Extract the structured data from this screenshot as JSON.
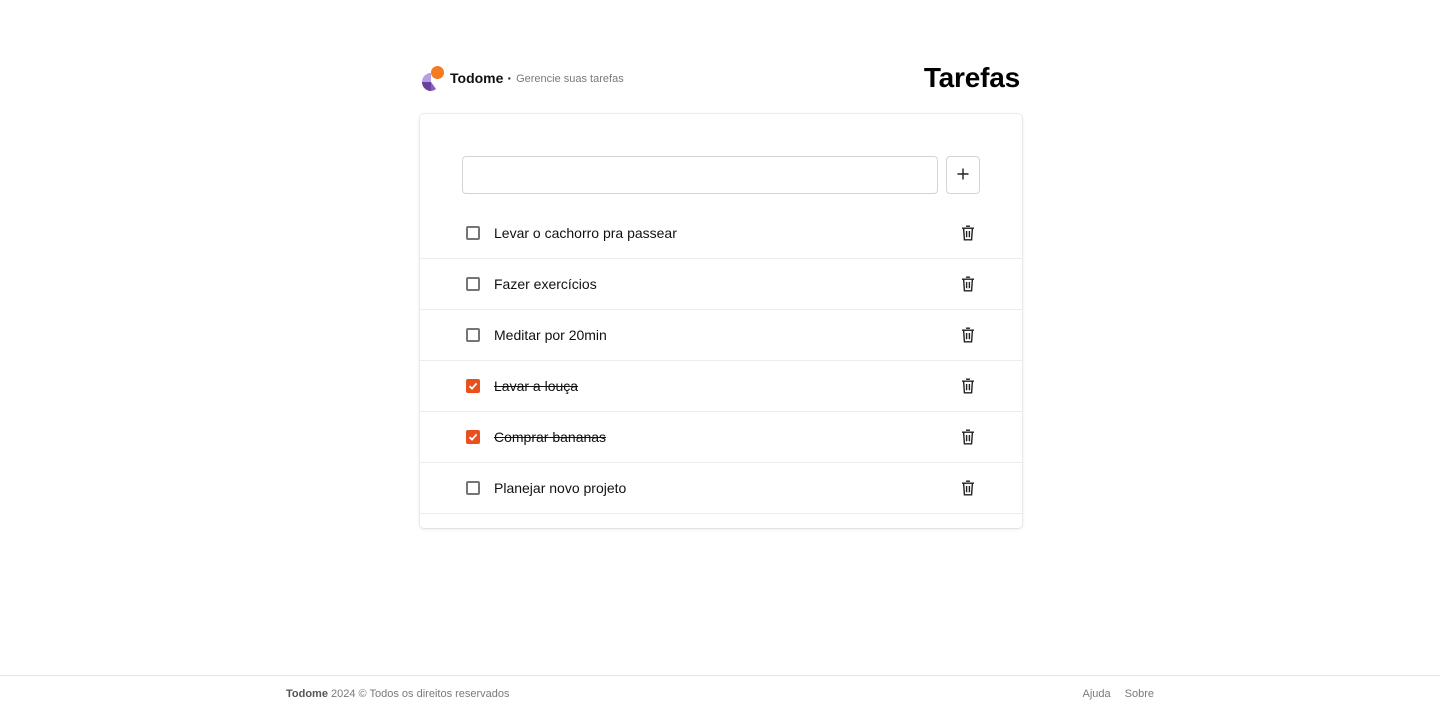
{
  "header": {
    "brand_name": "Todome",
    "separator": "·",
    "tagline": "Gerencie suas tarefas",
    "page_title": "Tarefas"
  },
  "add_task": {
    "input_value": "",
    "input_placeholder": "",
    "button_icon": "plus-icon"
  },
  "tasks": [
    {
      "label": "Levar o cachorro pra passear",
      "done": false
    },
    {
      "label": "Fazer exercícios",
      "done": false
    },
    {
      "label": "Meditar por 20min",
      "done": false
    },
    {
      "label": "Lavar a louça",
      "done": true
    },
    {
      "label": "Comprar bananas",
      "done": true
    },
    {
      "label": "Planejar novo projeto",
      "done": false
    }
  ],
  "footer": {
    "brand": "Todome",
    "copyright": "2024 © Todos os direitos reservados",
    "links": [
      "Ajuda",
      "Sobre"
    ]
  },
  "colors": {
    "accent": "#e8501e",
    "logo_orange": "#f47b20",
    "logo_purple": "#6b3fa0",
    "logo_lavender": "#b79ee0"
  }
}
